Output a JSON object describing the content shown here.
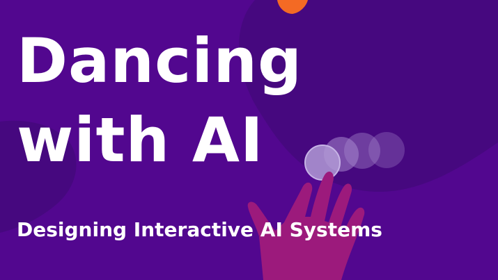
{
  "title": {
    "line1": "Dancing",
    "line2": "with AI"
  },
  "subtitle": "Designing Interactive AI Systems",
  "colors": {
    "background": "#52078f",
    "blob": "#46087f",
    "hand": "#9c1a7c",
    "orange": "#f46a24",
    "bubble": "#a889cd",
    "text": "#ffffff"
  },
  "icons": {
    "hand": "hand-icon",
    "leaf": "leaf-icon",
    "bubbles": "bubble-trail"
  }
}
